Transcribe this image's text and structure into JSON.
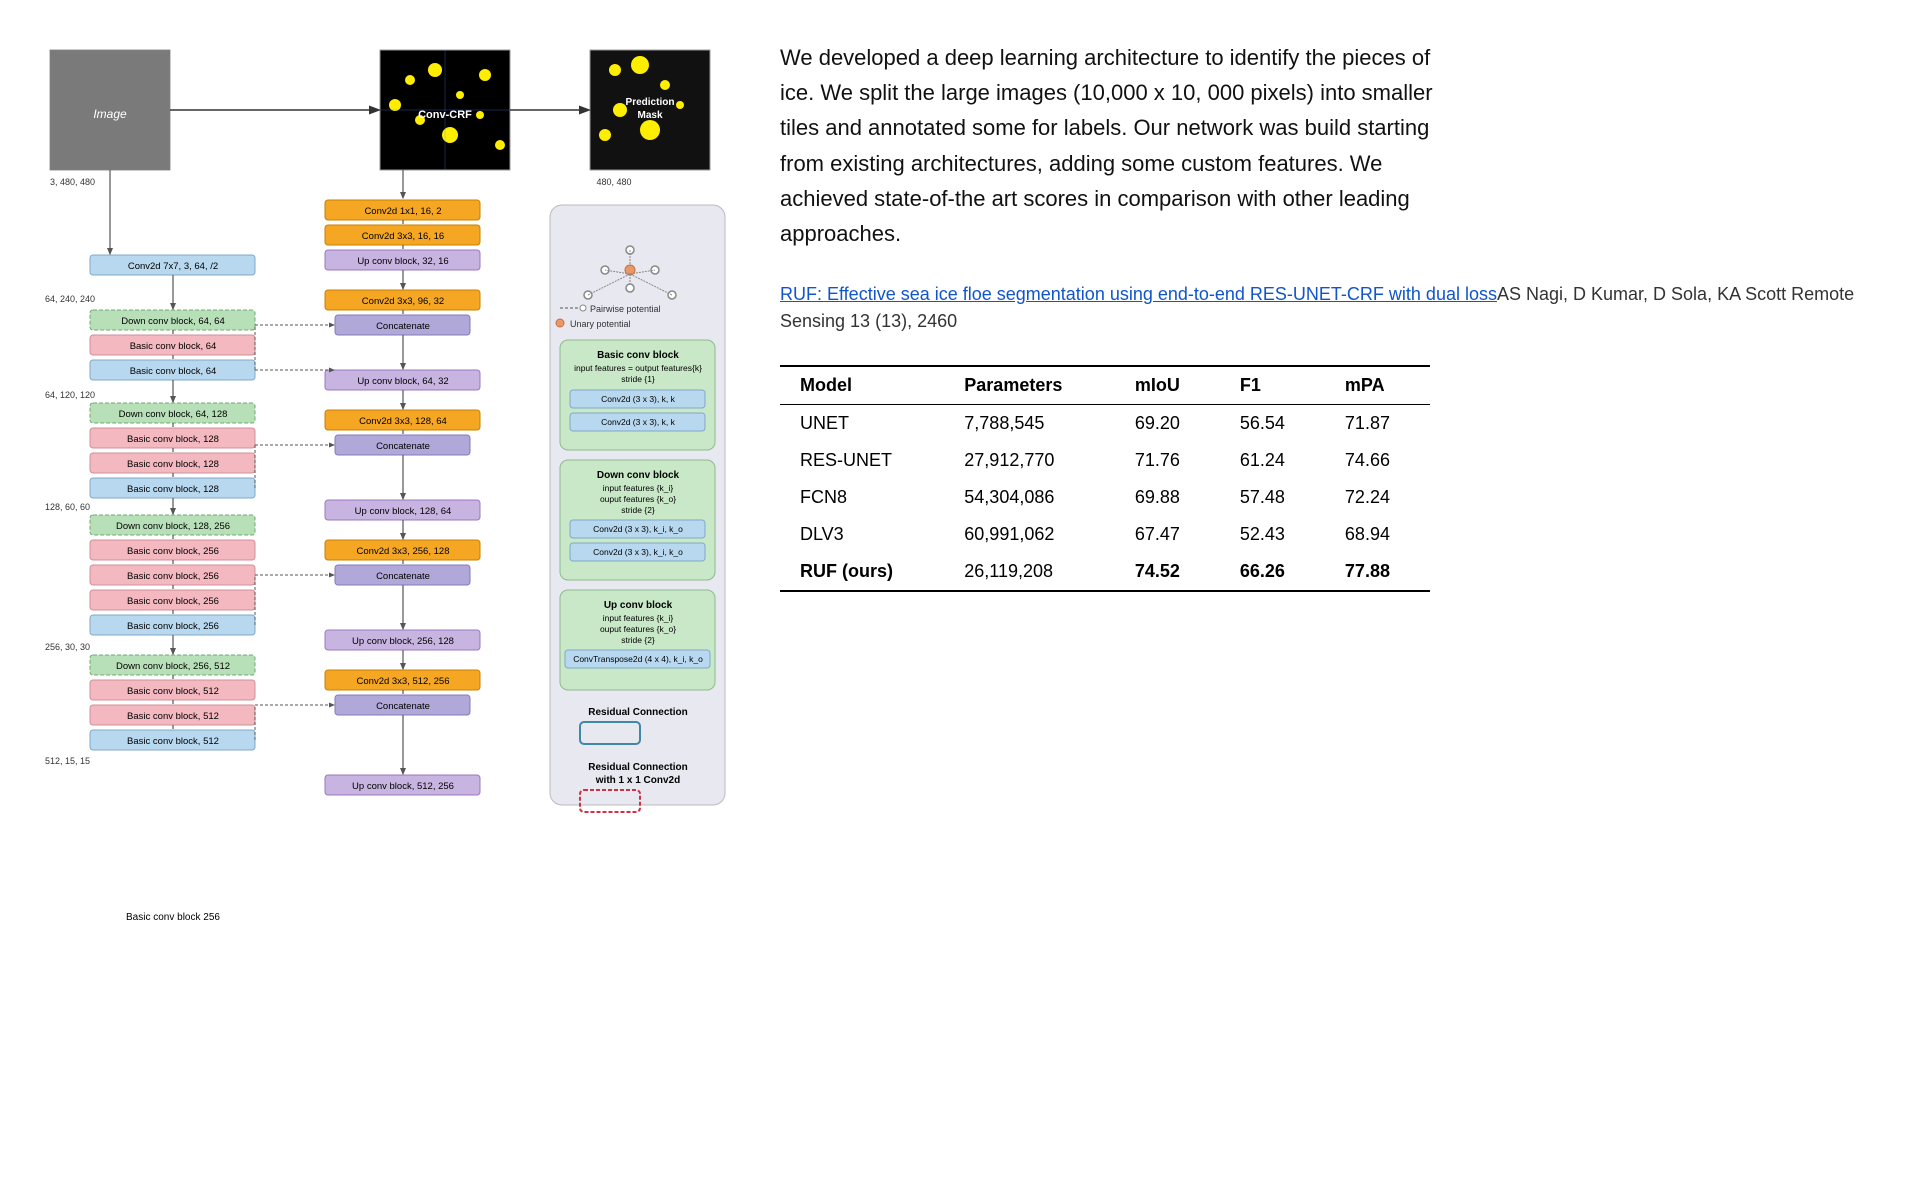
{
  "description": {
    "text": "We developed a deep learning architecture to identify the pieces of ice. We split the large images (10,000 x 10, 000 pixels) into smaller tiles and annotated some for labels. Our network was build starting from existing architectures, adding some custom features. We achieved state-of-the art scores in comparison with other leading approaches."
  },
  "citation": {
    "link_text": "RUF: Effective sea ice floe segmentation using end-to-end RES-UNET-CRF with dual loss",
    "rest_text": "AS Nagi, D Kumar, D Sola, KA Scott Remote Sensing 13 (13), 2460"
  },
  "images": {
    "input": {
      "label": "Image",
      "dim": "3, 480, 480"
    },
    "convcrf": {
      "label": "Conv-CRF",
      "dim": ""
    },
    "prediction": {
      "label": "Prediction Mask",
      "dim": "480, 480"
    }
  },
  "legend": {
    "pairwise": "Pairwise potential",
    "unary": "Unary potential"
  },
  "basic_conv_block": {
    "title": "Basic conv block",
    "desc1": "input features = output features{k}",
    "desc2": "stride {1}",
    "layers": [
      "Conv2d (3 x 3),  k,  k",
      "Conv2d (3 x 3),  k,  k"
    ]
  },
  "down_conv_block": {
    "title": "Down conv block",
    "desc1": "input features {k_i}",
    "desc2": "ouput features {k_o}",
    "desc3": "stride {2}",
    "layers": [
      "Conv2d (3 x 3), k_i, k_o",
      "Conv2d (3 x 3), k_i, k_o"
    ]
  },
  "up_conv_block": {
    "title": "Up conv block",
    "desc1": "input features {k_i}",
    "desc2": "ouput features {k_o}",
    "desc3": "stride {2}",
    "layers": [
      "ConvTranspose2d (4 x 4),  k_i,  k_o"
    ]
  },
  "residual": {
    "label": "Residual Connection"
  },
  "residual_1x1": {
    "label": "Residual Connection with 1 x 1 Conv2d"
  },
  "network_blocks": {
    "encoder": [
      {
        "type": "orange",
        "label": "Conv2d 1x1, 16, 2"
      },
      {
        "type": "orange",
        "label": "Conv2d 3x3, 16, 16"
      },
      {
        "type": "purple",
        "label": "Up conv block, 32, 16"
      },
      {
        "type": "orange",
        "label": "Conv2d 3x3, 96, 32"
      },
      {
        "type": "concat",
        "label": "Concatenate"
      },
      {
        "type": "purple",
        "label": "Up conv block, 64, 32"
      },
      {
        "type": "orange",
        "label": "Conv2d 3x3, 128, 64"
      },
      {
        "type": "concat",
        "label": "Concatenate"
      },
      {
        "type": "purple",
        "label": "Up conv block, 128, 64"
      },
      {
        "type": "orange",
        "label": "Conv2d 3x3, 256, 128"
      },
      {
        "type": "concat",
        "label": "Concatenate"
      },
      {
        "type": "purple",
        "label": "Up conv block, 256, 128"
      },
      {
        "type": "orange",
        "label": "Conv2d 3x3, 512, 256"
      },
      {
        "type": "concat",
        "label": "Concatenate"
      },
      {
        "type": "purple",
        "label": "Up conv block, 512, 256"
      }
    ],
    "left_col": [
      {
        "type": "gray",
        "label": "64, 240, 240",
        "is_dim": true
      },
      {
        "type": "blue",
        "label": "Conv2d 7x7, 3, 64, /2"
      },
      {
        "type": "green",
        "label": "Down conv block, 64, 64"
      },
      {
        "type": "pink",
        "label": "Basic conv block, 64"
      },
      {
        "type": "blue",
        "label": "Basic conv block, 64"
      },
      {
        "type": "gray",
        "label": "64, 120, 120",
        "is_dim": true
      },
      {
        "type": "green",
        "label": "Down conv block, 64, 128"
      },
      {
        "type": "pink",
        "label": "Basic conv block, 128"
      },
      {
        "type": "pink",
        "label": "Basic conv block, 128"
      },
      {
        "type": "blue",
        "label": "Basic conv block, 128"
      },
      {
        "type": "gray",
        "label": "128, 60, 60",
        "is_dim": true
      },
      {
        "type": "green",
        "label": "Down conv block, 128, 256"
      },
      {
        "type": "pink",
        "label": "Basic conv block, 256"
      },
      {
        "type": "pink",
        "label": "Basic conv block, 256"
      },
      {
        "type": "pink",
        "label": "Basic conv block, 256"
      },
      {
        "type": "blue",
        "label": "Basic conv block, 256"
      },
      {
        "type": "gray",
        "label": "256, 30, 30",
        "is_dim": true
      },
      {
        "type": "green",
        "label": "Down conv block, 256, 512"
      },
      {
        "type": "pink",
        "label": "Basic conv block, 512"
      },
      {
        "type": "pink",
        "label": "Basic conv block, 512"
      },
      {
        "type": "blue",
        "label": "Basic conv block, 512"
      },
      {
        "type": "gray",
        "label": "512, 15, 15",
        "is_dim": true
      }
    ]
  },
  "table": {
    "headers": [
      "Model",
      "Parameters",
      "mIoU",
      "F1",
      "mPA"
    ],
    "rows": [
      {
        "model": "UNET",
        "params": "7,788,545",
        "miou": "69.20",
        "f1": "56.54",
        "mpa": "71.87",
        "bold": false
      },
      {
        "model": "RES-UNET",
        "params": "27,912,770",
        "miou": "71.76",
        "f1": "61.24",
        "mpa": "74.66",
        "bold": false
      },
      {
        "model": "FCN8",
        "params": "54,304,086",
        "miou": "69.88",
        "f1": "57.48",
        "mpa": "72.24",
        "bold": false
      },
      {
        "model": "DLV3",
        "params": "60,991,062",
        "miou": "67.47",
        "f1": "52.43",
        "mpa": "68.94",
        "bold": false
      },
      {
        "model": "RUF (ours)",
        "params": "26,119,208",
        "miou": "74.52",
        "f1": "66.26",
        "mpa": "77.88",
        "bold": true
      }
    ]
  }
}
